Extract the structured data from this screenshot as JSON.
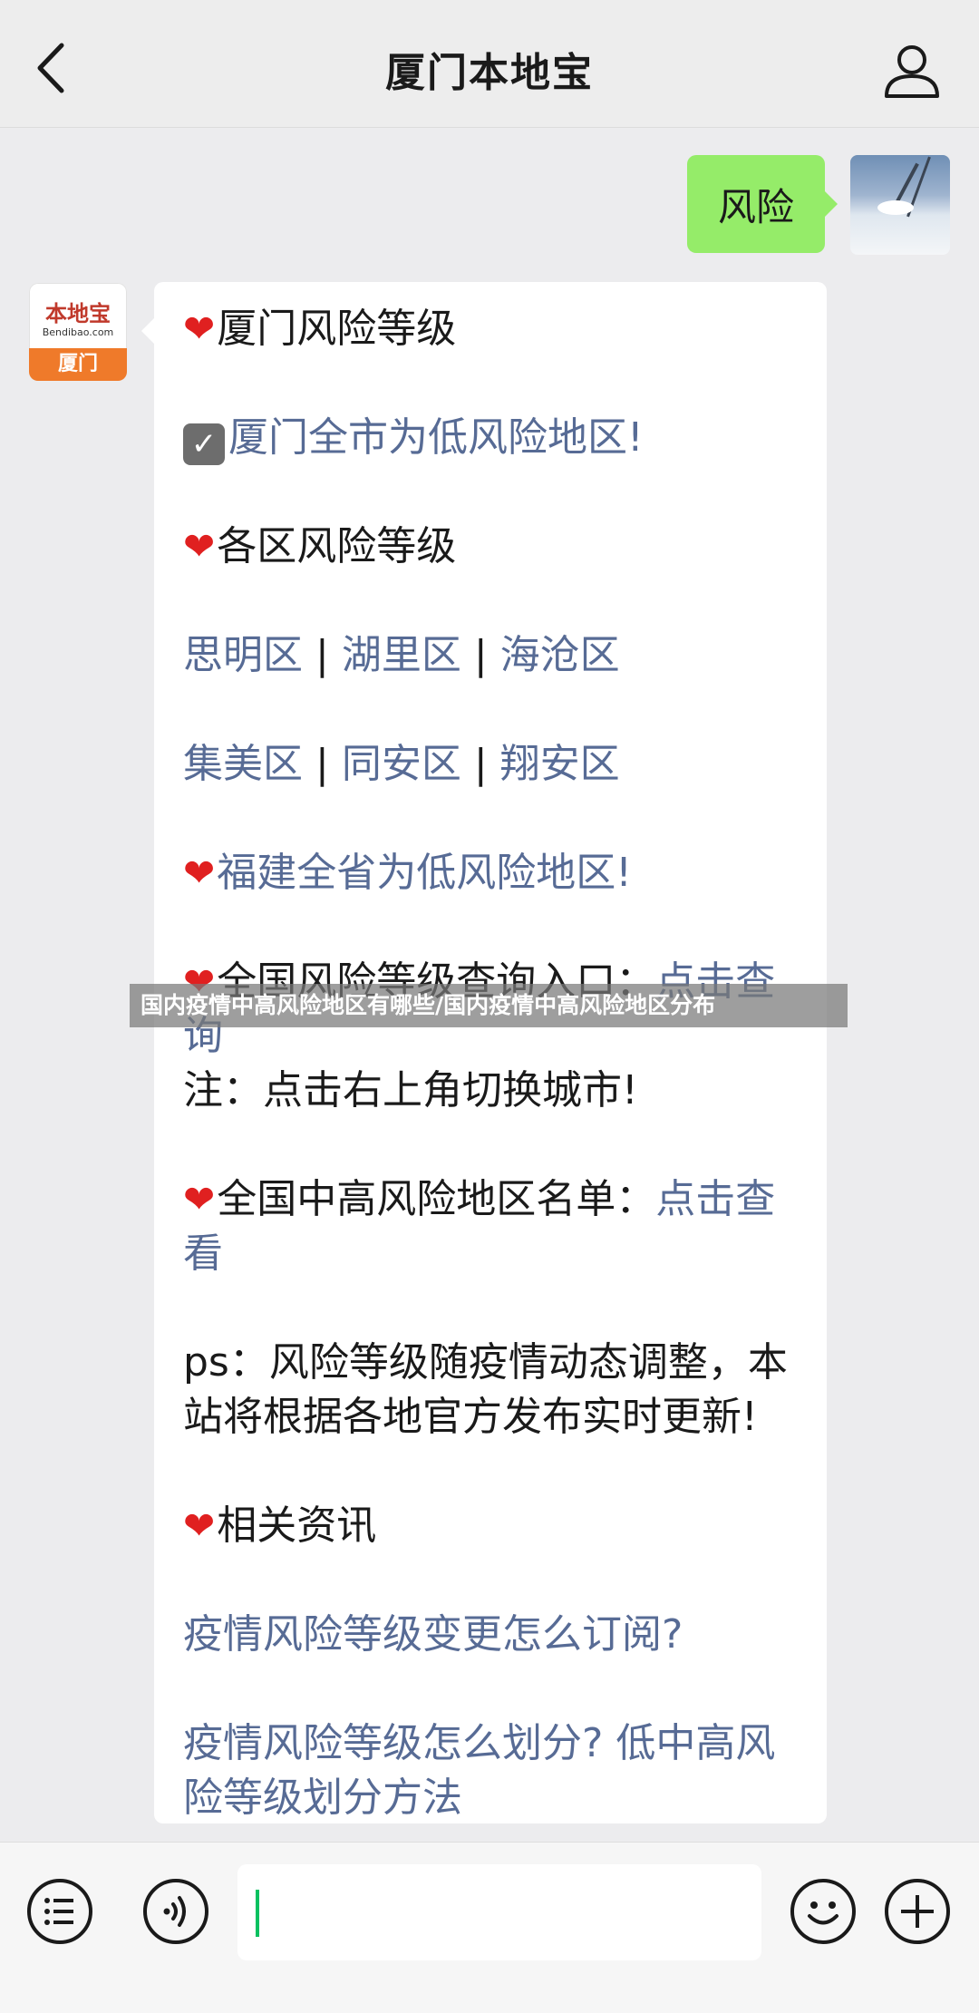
{
  "header": {
    "title": "厦门本地宝",
    "back_icon": "chevron-left-icon",
    "user_icon": "person-icon"
  },
  "my_message": {
    "text": "风险",
    "bubble_color": "#95ec69"
  },
  "bot": {
    "logo_top": "本地宝",
    "logo_url": "Bendibao.com",
    "logo_city": "厦门"
  },
  "bot_message": {
    "heading_risk": "厦门风险等级",
    "city_status": "厦门全市为低风险地区!",
    "heading_district": "各区风险等级",
    "district_row1": [
      "思明区",
      "湖里区",
      "海沧区"
    ],
    "district_row2": [
      "集美区",
      "同安区",
      "翔安区"
    ],
    "province_status": "福建全省为低风险地区!",
    "national_query_label": "全国风险等级查询入口：",
    "national_query_link_a": "点击查",
    "national_query_link_b": "询",
    "note": "注：点击右上角切换城市!",
    "list_label": "全国中高风险地区名单：",
    "list_link_a": "点击查",
    "list_link_b": "看",
    "ps_line1": "ps：风险等级随疫情动态调整，本",
    "ps_line2": "站将根据各地官方发布实时更新!",
    "related_heading": "相关资讯",
    "related_link1": "疫情风险等级变更怎么订阅?",
    "related_link2_a": "疫情风险等级怎么划分? 低中高风",
    "related_link2_b": "险等级划分方法",
    "separator": "|"
  },
  "watermark": "国内疫情中高风险地区有哪些/国内疫情中高风险地区分布",
  "input_bar": {
    "menu_icon": "list-menu-icon",
    "voice_icon": "voice-icon",
    "emoji_icon": "emoji-icon",
    "plus_icon": "plus-icon",
    "text_value": ""
  },
  "colors": {
    "link": "#576b95",
    "heart": "#e02020",
    "cursor": "#07c160"
  }
}
